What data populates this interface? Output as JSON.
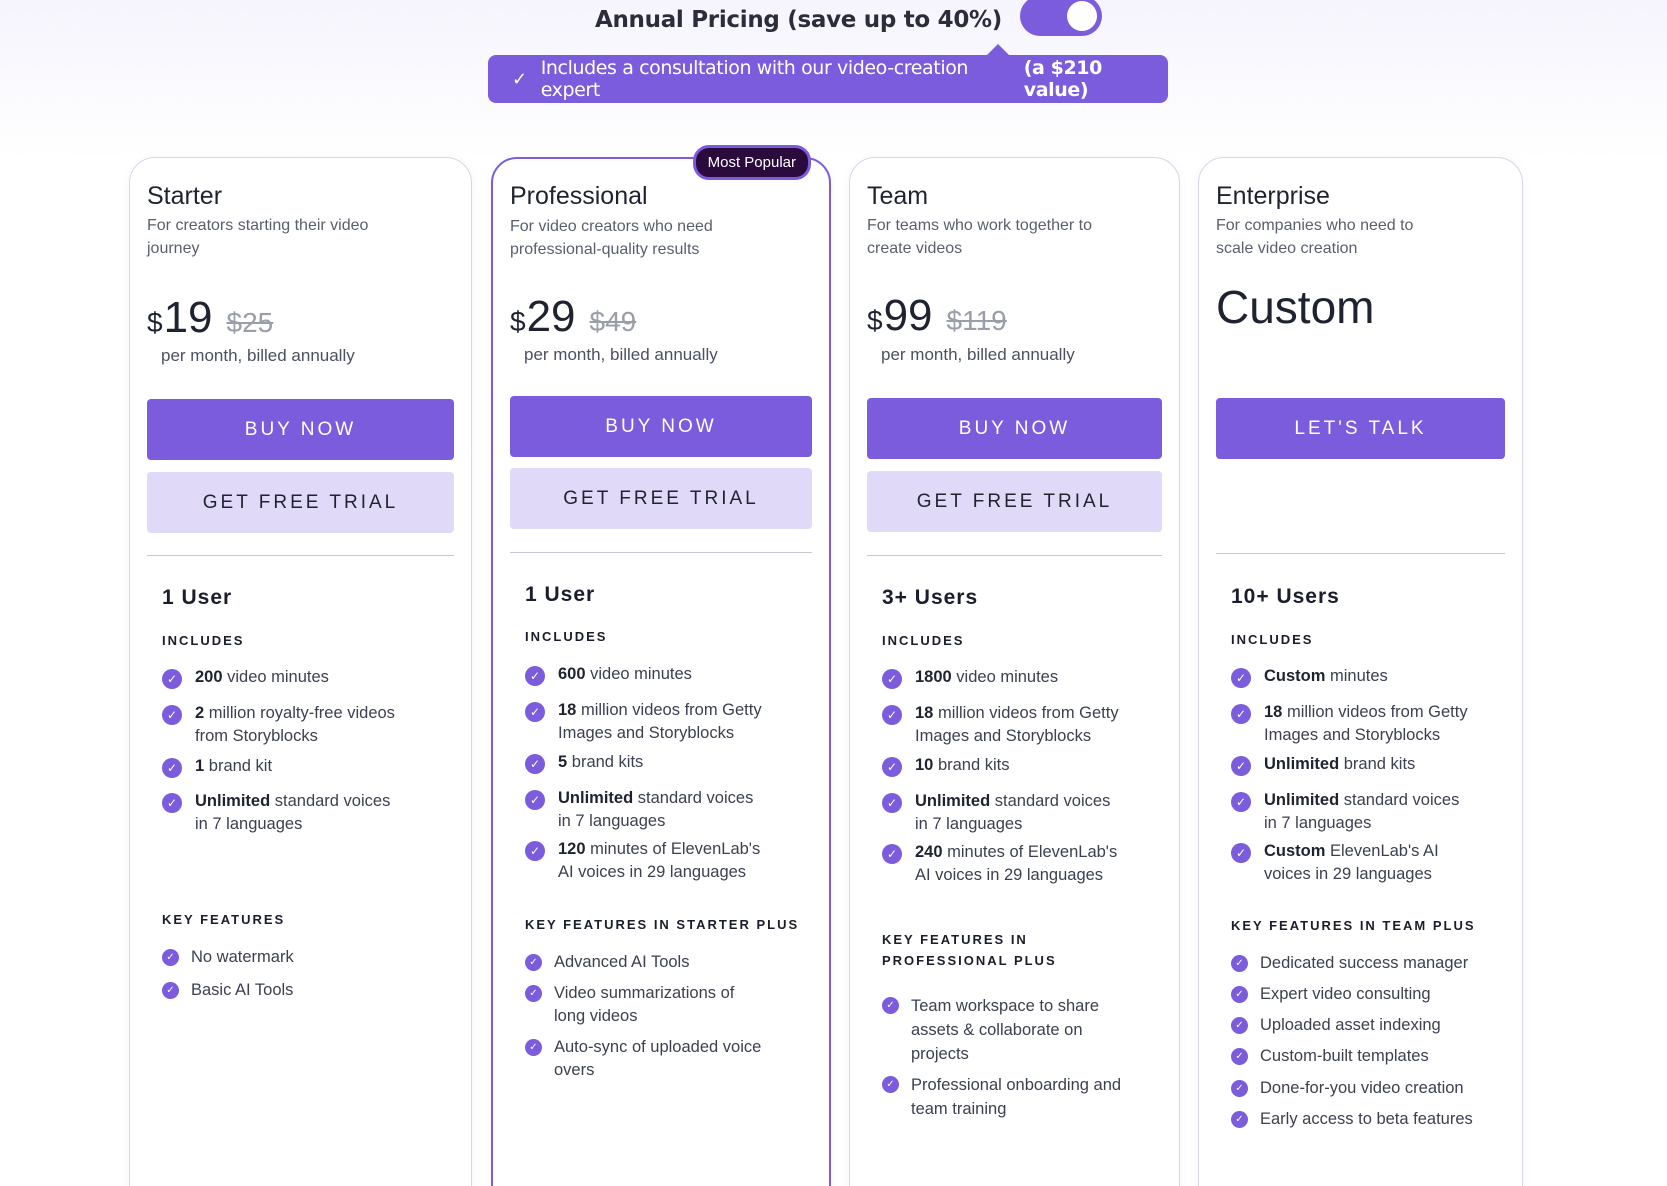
{
  "header": {
    "toggle_label": "Annual Pricing (save up to 40%)",
    "toggle_on": true,
    "callout_text": "Includes a consultation with our video-creation expert",
    "callout_bold": "(a $210 value)"
  },
  "colors": {
    "accent": "#7b5cdc",
    "accent_light": "#e0d9f8",
    "badge_bg": "#2b0a3d"
  },
  "plans": [
    {
      "name": "Starter",
      "description": "For creators starting their video journey",
      "currency": "$",
      "price": "19",
      "old_price": "$25",
      "billing": "per month, billed annually",
      "primary_cta": "BUY NOW",
      "secondary_cta": "GET FREE TRIAL",
      "users": "1 User",
      "includes_label": "INCLUDES",
      "includes": [
        {
          "bold": "200",
          "text": " video minutes"
        },
        {
          "bold": "2",
          "text": " million royalty-free videos from Storyblocks"
        },
        {
          "bold": "1",
          "text": " brand kit"
        },
        {
          "bold": "Unlimited",
          "text": " standard voices in 7 languages"
        }
      ],
      "features_label": "KEY FEATURES",
      "features": [
        "No watermark",
        "Basic AI Tools"
      ]
    },
    {
      "name": "Professional",
      "badge": "Most Popular",
      "description": "For video creators who need professional-quality results",
      "currency": "$",
      "price": "29",
      "old_price": "$49",
      "billing": "per month, billed annually",
      "primary_cta": "BUY NOW",
      "secondary_cta": "GET FREE TRIAL",
      "users": "1 User",
      "includes_label": "INCLUDES",
      "includes": [
        {
          "bold": "600",
          "text": " video minutes"
        },
        {
          "bold": "18",
          "text": " million videos from Getty Images and Storyblocks"
        },
        {
          "bold": "5",
          "text": " brand kits"
        },
        {
          "bold": "Unlimited",
          "text": " standard voices in 7 languages"
        },
        {
          "bold": "120",
          "text": " minutes of ElevenLab's AI voices in 29 languages"
        }
      ],
      "features_label": "KEY FEATURES IN STARTER PLUS",
      "features": [
        "Advanced AI Tools",
        "Video summarizations of long videos",
        "Auto-sync of uploaded voice overs"
      ]
    },
    {
      "name": "Team",
      "description": "For teams who work together to create videos",
      "currency": "$",
      "price": "99",
      "old_price": "$119",
      "billing": "per month, billed annually",
      "primary_cta": "BUY NOW",
      "secondary_cta": "GET FREE TRIAL",
      "users": "3+ Users",
      "includes_label": "INCLUDES",
      "includes": [
        {
          "bold": "1800",
          "text": " video minutes"
        },
        {
          "bold": "18",
          "text": " million videos from Getty Images and Storyblocks"
        },
        {
          "bold": "10",
          "text": " brand kits"
        },
        {
          "bold": "Unlimited",
          "text": " standard voices in 7 languages"
        },
        {
          "bold": "240",
          "text": " minutes of ElevenLab's AI voices in 29 languages"
        }
      ],
      "features_label": "KEY FEATURES IN PROFESSIONAL PLUS",
      "features": [
        "Team workspace to share assets & collaborate on projects",
        "Professional onboarding and team training"
      ]
    },
    {
      "name": "Enterprise",
      "description": "For companies who need  to scale video creation",
      "custom_price": "Custom",
      "primary_cta": "LET'S TALK",
      "users": "10+ Users",
      "includes_label": "INCLUDES",
      "includes": [
        {
          "bold": "Custom",
          "text": " minutes"
        },
        {
          "bold": "18",
          "text": " million videos from Getty Images and Storyblocks"
        },
        {
          "bold": "Unlimited",
          "text": " brand kits"
        },
        {
          "bold": "Unlimited",
          "text": " standard voices in 7 languages"
        },
        {
          "bold": "Custom",
          "text": " ElevenLab's AI voices in 29 languages"
        }
      ],
      "features_label": "KEY FEATURES IN TEAM PLUS",
      "features": [
        "Dedicated success manager",
        "Expert video consulting",
        "Uploaded asset indexing",
        "Custom-built templates",
        "Done-for-you video creation",
        "Early access to beta features"
      ]
    }
  ]
}
